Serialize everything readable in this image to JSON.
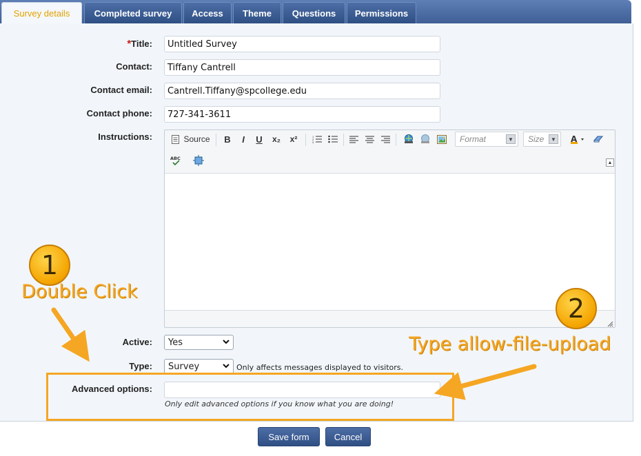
{
  "tabs": [
    {
      "label": "Survey details"
    },
    {
      "label": "Completed survey"
    },
    {
      "label": "Access"
    },
    {
      "label": "Theme"
    },
    {
      "label": "Questions"
    },
    {
      "label": "Permissions"
    }
  ],
  "form": {
    "title_label": "Title:",
    "title_required_mark": "*",
    "title_value": "Untitled Survey",
    "contact_label": "Contact:",
    "contact_value": "Tiffany Cantrell",
    "contact_email_label": "Contact email:",
    "contact_email_value": "Cantrell.Tiffany@spcollege.edu",
    "contact_phone_label": "Contact phone:",
    "contact_phone_value": "727-341-3611",
    "instructions_label": "Instructions:",
    "active_label": "Active:",
    "active_value": "Yes",
    "type_label": "Type:",
    "type_value": "Survey",
    "type_hint": "Only affects messages displayed to visitors.",
    "advanced_label": "Advanced options:",
    "advanced_value": "",
    "advanced_hint": "Only edit advanced options if you know what you are doing!"
  },
  "editor": {
    "source_label": "Source",
    "bold": "B",
    "italic": "I",
    "underline": "U",
    "subscript": "x₂",
    "superscript": "x²",
    "format_placeholder": "Format",
    "size_placeholder": "Size",
    "spell_label": "ABC"
  },
  "annotations": {
    "step1_number": "1",
    "step1_text": "Double Click",
    "step2_number": "2",
    "step2_text": "Type allow-file-upload",
    "accent_color": "#f5a623"
  },
  "buttons": {
    "save": "Save form",
    "cancel": "Cancel"
  }
}
